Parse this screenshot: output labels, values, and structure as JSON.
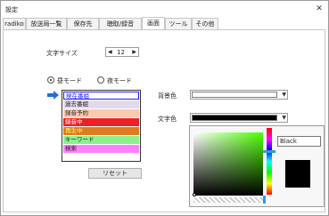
{
  "window": {
    "title": "設定",
    "close_glyph": "✕"
  },
  "tabs": [
    {
      "label": "radiko",
      "active": false
    },
    {
      "label": "放送局一覧",
      "active": false
    },
    {
      "label": "保存先",
      "active": false
    },
    {
      "label": "聴取/録音",
      "active": false
    },
    {
      "label": "画面",
      "active": true
    },
    {
      "label": "ツール",
      "active": false
    },
    {
      "label": "その他",
      "active": false
    }
  ],
  "font_size": {
    "label": "文字サイズ",
    "value": "12",
    "dec_glyph": "◀",
    "inc_glyph": "▶"
  },
  "mode": {
    "options": [
      {
        "label": "昼モード",
        "selected": true
      },
      {
        "label": "夜モード",
        "selected": false
      }
    ]
  },
  "list": {
    "items": [
      {
        "label": "現在番組",
        "bg": "#ffffff",
        "fg": "#1a1aff",
        "selected": true
      },
      {
        "label": "過去番組",
        "bg": "#e3d9ef",
        "fg": "#222222",
        "selected": false
      },
      {
        "label": "録音予約",
        "bg": "#f8cbad",
        "fg": "#222222",
        "selected": false
      },
      {
        "label": "録音中",
        "bg": "#ed2024",
        "fg": "#ffffff",
        "selected": false
      },
      {
        "label": "再生中",
        "bg": "#e07a20",
        "fg": "#ffff66",
        "selected": false
      },
      {
        "label": "キーワード",
        "bg": "#8df08d",
        "fg": "#222222",
        "selected": false
      },
      {
        "label": "検索",
        "bg": "#ff80ff",
        "fg": "#222222",
        "selected": false
      }
    ]
  },
  "reset_button": {
    "label": "リセット"
  },
  "background_color": {
    "label": "背景色",
    "value": "#ffffff"
  },
  "text_color": {
    "label": "文字色",
    "value": "#000000"
  },
  "picker": {
    "color_name": "Black",
    "preview_color": "#000000"
  },
  "colors": {
    "accent": "#2aa0d8",
    "arrow": "#1e6fd9"
  }
}
